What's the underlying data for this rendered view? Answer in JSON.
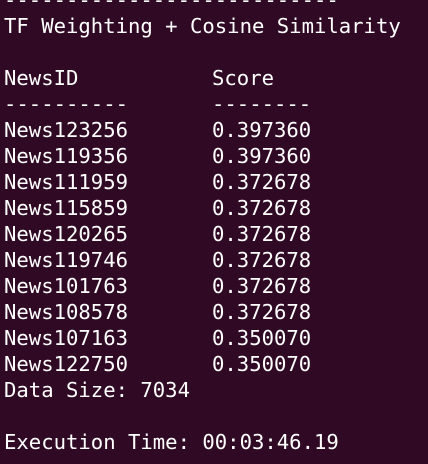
{
  "terminal": {
    "top_rule": "---------------------------",
    "title": "TF Weighting + Cosine Similarity",
    "columns": {
      "id_header": "NewsID",
      "score_header": "Score",
      "id_rule": "----------",
      "score_rule": "--------"
    },
    "rows": [
      {
        "id": "News123256",
        "score": "0.397360"
      },
      {
        "id": "News119356",
        "score": "0.397360"
      },
      {
        "id": "News111959",
        "score": "0.372678"
      },
      {
        "id": "News115859",
        "score": "0.372678"
      },
      {
        "id": "News120265",
        "score": "0.372678"
      },
      {
        "id": "News119746",
        "score": "0.372678"
      },
      {
        "id": "News101763",
        "score": "0.372678"
      },
      {
        "id": "News108578",
        "score": "0.372678"
      },
      {
        "id": "News107163",
        "score": "0.350070"
      },
      {
        "id": "News122750",
        "score": "0.350070"
      }
    ],
    "data_size": "Data Size: 7034",
    "execution_time": "Execution Time: 00:03:46.19"
  },
  "colors": {
    "background": "#300a24",
    "foreground": "#ffffff"
  }
}
